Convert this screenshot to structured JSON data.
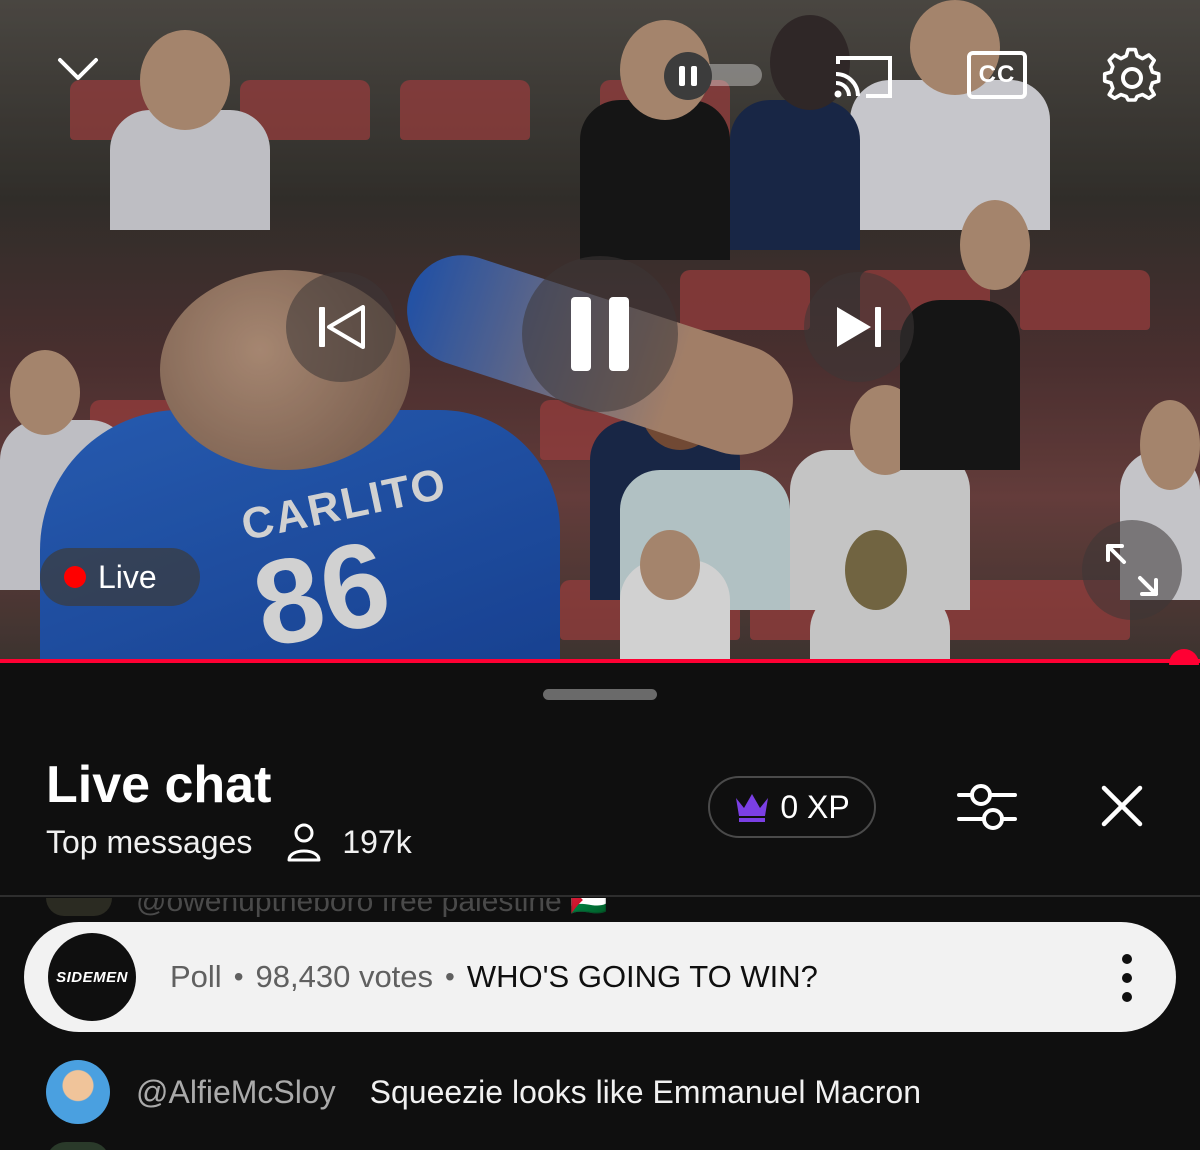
{
  "player": {
    "state": "playing",
    "live_label": "Live",
    "cc_label": "CC",
    "jersey_name": "CARLITO",
    "jersey_number": "86",
    "progress_fraction": 1.0,
    "accent_color": "#ff0033",
    "icons": [
      "chevron-down-icon",
      "autoplay-toggle-icon",
      "cast-icon",
      "cc-icon",
      "gear-icon",
      "previous-icon",
      "pause-icon",
      "next-icon",
      "live-dot-icon",
      "fullscreen-icon"
    ]
  },
  "chat": {
    "title": "Live chat",
    "mode": "Top messages",
    "viewers": "197k",
    "xp_label": "0 XP",
    "ghost_message": "@owenuptheboro   free palestine 🇵🇸",
    "poll": {
      "logo_text": "SIDEMEN",
      "type": "Poll",
      "votes": "98,430 votes",
      "question": "WHO'S GOING TO WIN?",
      "separator": "•"
    },
    "messages": [
      {
        "author": "@AlfieMcSloy",
        "text": "Squeezie looks like Emmanuel Macron"
      }
    ]
  }
}
